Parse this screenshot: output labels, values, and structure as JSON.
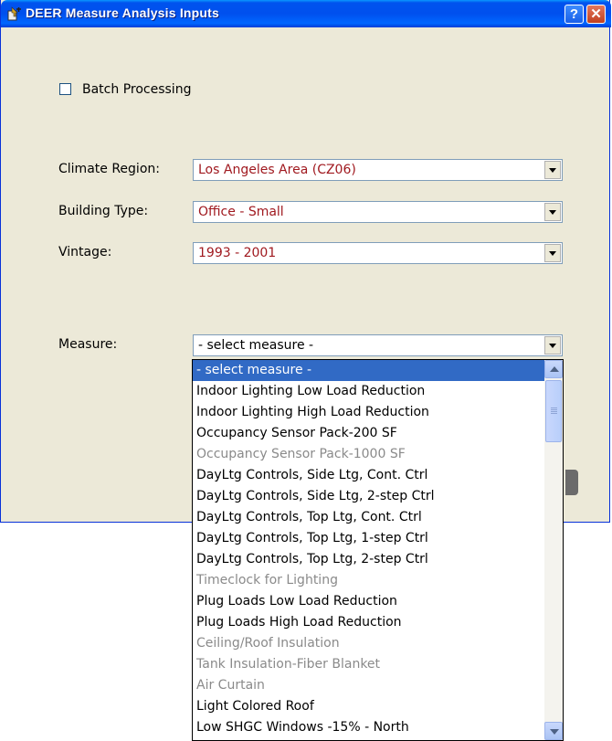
{
  "window": {
    "title": "DEER Measure Analysis Inputs",
    "help_label": "?",
    "close_label": "✕"
  },
  "batch": {
    "label": "Batch Processing",
    "checked": false
  },
  "fields": {
    "climate_label": "Climate Region:",
    "climate_value": "Los Angeles Area (CZ06)",
    "building_label": "Building Type:",
    "building_value": "Office - Small",
    "vintage_label": "Vintage:",
    "vintage_value": "1993 - 2001",
    "measure_label": "Measure:",
    "measure_value": "- select measure -"
  },
  "measure_options": [
    {
      "label": "- select measure -",
      "state": "selected"
    },
    {
      "label": "Indoor Lighting Low Load Reduction",
      "state": "enabled"
    },
    {
      "label": "Indoor Lighting High Load Reduction",
      "state": "enabled"
    },
    {
      "label": "Occupancy Sensor Pack-200 SF",
      "state": "enabled"
    },
    {
      "label": "Occupancy Sensor Pack-1000 SF",
      "state": "disabled"
    },
    {
      "label": "DayLtg Controls, Side Ltg, Cont. Ctrl",
      "state": "enabled"
    },
    {
      "label": "DayLtg Controls, Side Ltg, 2-step Ctrl",
      "state": "enabled"
    },
    {
      "label": "DayLtg Controls, Top Ltg, Cont. Ctrl",
      "state": "enabled"
    },
    {
      "label": "DayLtg Controls, Top Ltg, 1-step Ctrl",
      "state": "enabled"
    },
    {
      "label": "DayLtg Controls, Top Ltg, 2-step Ctrl",
      "state": "enabled"
    },
    {
      "label": "Timeclock for Lighting",
      "state": "disabled"
    },
    {
      "label": "Plug Loads Low Load Reduction",
      "state": "enabled"
    },
    {
      "label": "Plug Loads High Load Reduction",
      "state": "enabled"
    },
    {
      "label": "Ceiling/Roof Insulation",
      "state": "disabled"
    },
    {
      "label": "Tank Insulation-Fiber Blanket",
      "state": "disabled"
    },
    {
      "label": "Air Curtain",
      "state": "disabled"
    },
    {
      "label": "Light Colored Roof",
      "state": "enabled"
    },
    {
      "label": "Low SHGC Windows -15% - North",
      "state": "enabled"
    }
  ],
  "colors": {
    "titlebar": "#0054e3",
    "window_bg": "#ece9d8",
    "value_text": "#a0191f",
    "selection": "#316ac5",
    "disabled_text": "#8a8a8a"
  },
  "icons": {
    "title": "app-window-icon",
    "scroll_up": "chevron-up-icon",
    "scroll_down": "chevron-down-icon"
  }
}
